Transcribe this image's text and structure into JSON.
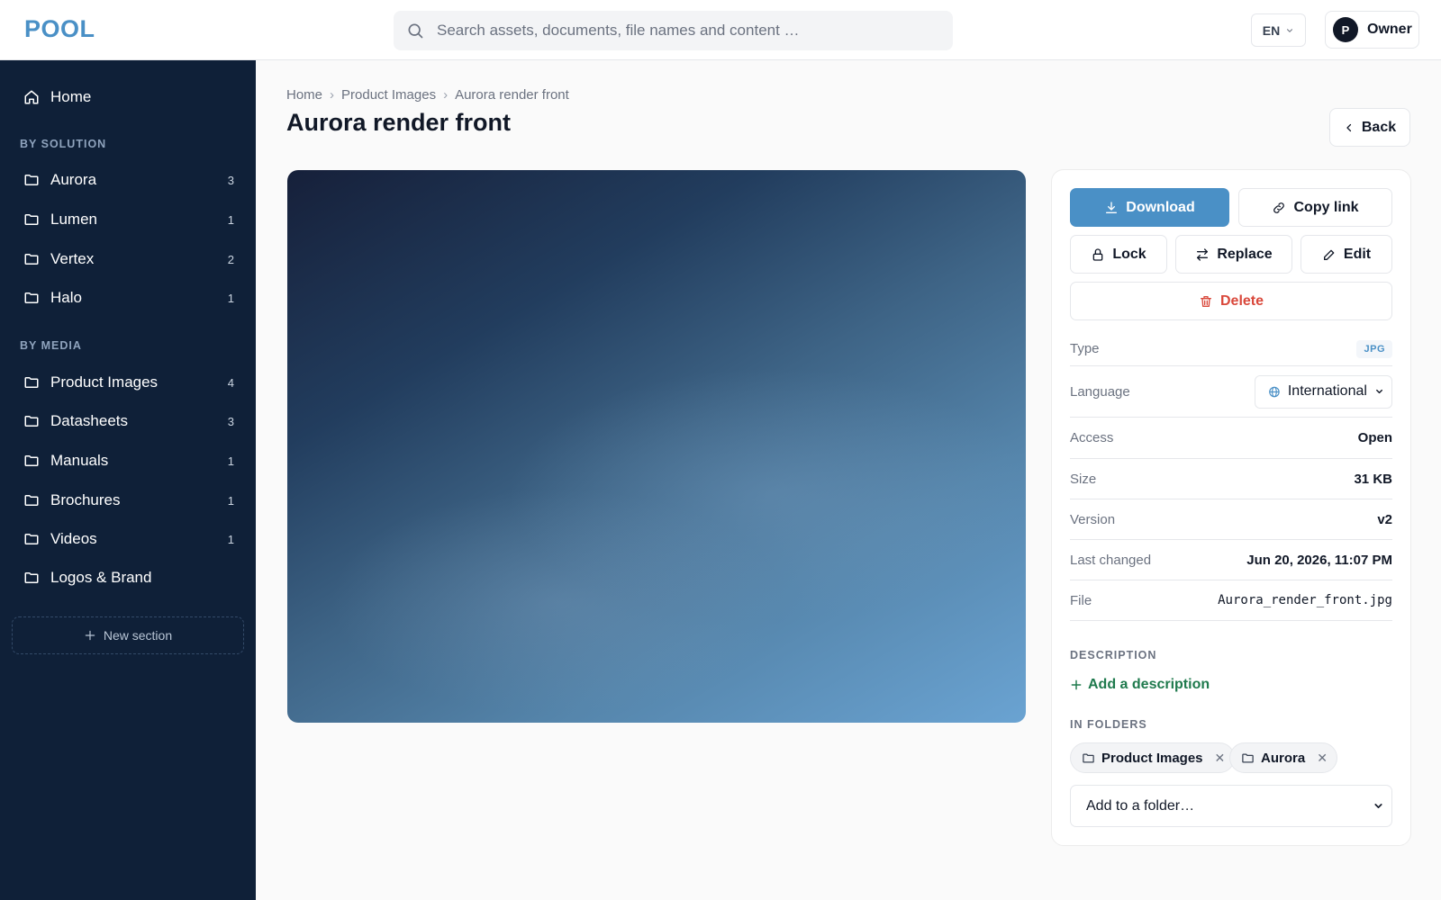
{
  "app": {
    "logo": "POOL"
  },
  "topbar": {
    "search_placeholder": "Search assets, documents, file names and content …",
    "language": "EN",
    "user_initial": "P",
    "user_name": "Owner"
  },
  "sidebar": {
    "home_label": "Home",
    "by_solution_title": "BY SOLUTION",
    "solutions": [
      {
        "label": "Aurora",
        "count": "3"
      },
      {
        "label": "Lumen",
        "count": "1"
      },
      {
        "label": "Vertex",
        "count": "2"
      },
      {
        "label": "Halo",
        "count": "1"
      }
    ],
    "by_media_title": "BY MEDIA",
    "media": [
      {
        "label": "Product Images",
        "count": "4"
      },
      {
        "label": "Datasheets",
        "count": "3"
      },
      {
        "label": "Manuals",
        "count": "1"
      },
      {
        "label": "Brochures",
        "count": "1"
      },
      {
        "label": "Videos",
        "count": "1"
      },
      {
        "label": "Logos & Brand",
        "count": ""
      }
    ],
    "new_section_label": "New section"
  },
  "breadcrumb": [
    "Home",
    "Product Images",
    "Aurora render front"
  ],
  "page": {
    "title": "Aurora render front",
    "back_label": "Back"
  },
  "actions": {
    "download": "Download",
    "copy_link": "Copy link",
    "lock": "Lock",
    "replace": "Replace",
    "edit": "Edit",
    "delete": "Delete"
  },
  "details": {
    "type_label": "Type",
    "type_value": "JPG",
    "language_label": "Language",
    "language_value": "International",
    "access_label": "Access",
    "access_value": "Open",
    "size_label": "Size",
    "size_value": "31 KB",
    "version_label": "Version",
    "version_value": "v2",
    "last_changed_label": "Last changed",
    "last_changed_value": "Jun 20, 2026, 11:07 PM",
    "file_label": "File",
    "file_value": "Aurora_render_front.jpg"
  },
  "description": {
    "title": "DESCRIPTION",
    "add_label": "Add a description"
  },
  "folders": {
    "title": "IN FOLDERS",
    "chips": [
      "Product Images",
      "Aurora"
    ],
    "add_placeholder": "Add to a folder…"
  },
  "colors": {
    "accent": "#4a90c6",
    "sidebar_bg": "#0f2038",
    "danger": "#d9483b",
    "success": "#1f7a4d"
  }
}
